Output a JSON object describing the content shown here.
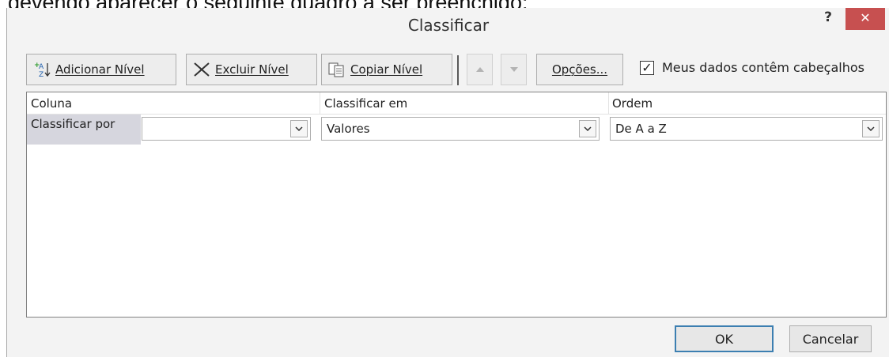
{
  "background_text": "devendo aparecer o seguinte quadro a ser preenchido:",
  "dialog": {
    "title": "Classificar",
    "help": "?",
    "close": "✕"
  },
  "toolbar": {
    "add_level": "Adicionar Nível",
    "delete_level": "Excluir Nível",
    "copy_level": "Copiar Nível",
    "options": "Opções...",
    "header_checkbox": "Meus dados contêm cabeçalhos",
    "header_checked": true
  },
  "grid": {
    "headers": {
      "column": "Coluna",
      "sort_on": "Classificar em",
      "order": "Ordem"
    },
    "row": {
      "label": "Classificar por",
      "column_value": "",
      "sort_on_value": "Valores",
      "order_value": "De A a Z"
    }
  },
  "buttons": {
    "ok": "OK",
    "cancel": "Cancelar"
  },
  "colors": {
    "close_bg": "#c75050",
    "ok_border": "#3c7fb1",
    "row_label_bg": "#d6d6de"
  }
}
